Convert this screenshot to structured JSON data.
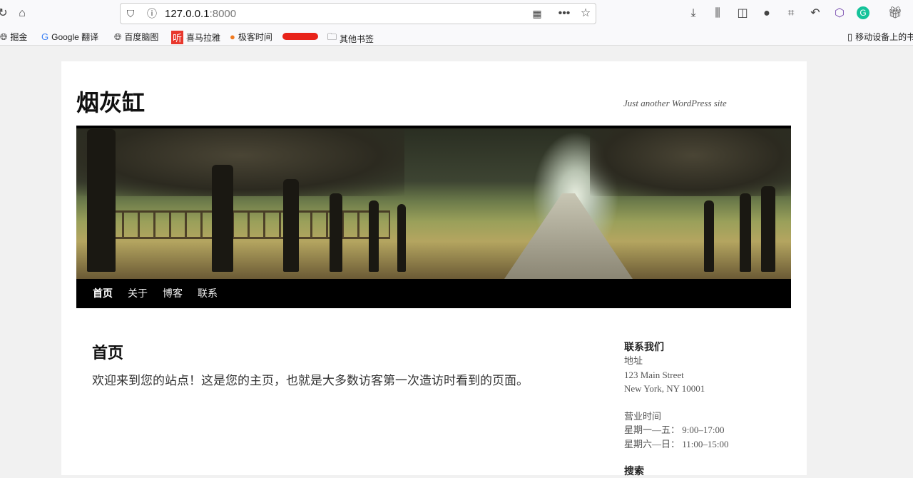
{
  "browser": {
    "url_host": "127.0.0.1",
    "url_port": ":8000",
    "bookmarks": [
      "掘金",
      "Google 翻译",
      "百度脑图",
      "喜马拉雅",
      "极客时间",
      "其他书签"
    ],
    "mobile_bookmarks": "移动设备上的书签"
  },
  "site": {
    "title": "烟灰缸",
    "tagline": "Just another WordPress site",
    "nav": [
      "首页",
      "关于",
      "博客",
      "联系"
    ]
  },
  "main": {
    "title": "首页",
    "content": "欢迎来到您的站点！这是您的主页，也就是大多数访客第一次造访时看到的页面。"
  },
  "sidebar": {
    "heading": "联系我们",
    "address_label": "地址",
    "address1": "123 Main Street",
    "address2": "New York, NY 10001",
    "hours_label": "营业时间",
    "hours1": "星期一—五：  9:00–17:00",
    "hours2": "星期六—日：  11:00–15:00",
    "next_heading": "搜索"
  }
}
